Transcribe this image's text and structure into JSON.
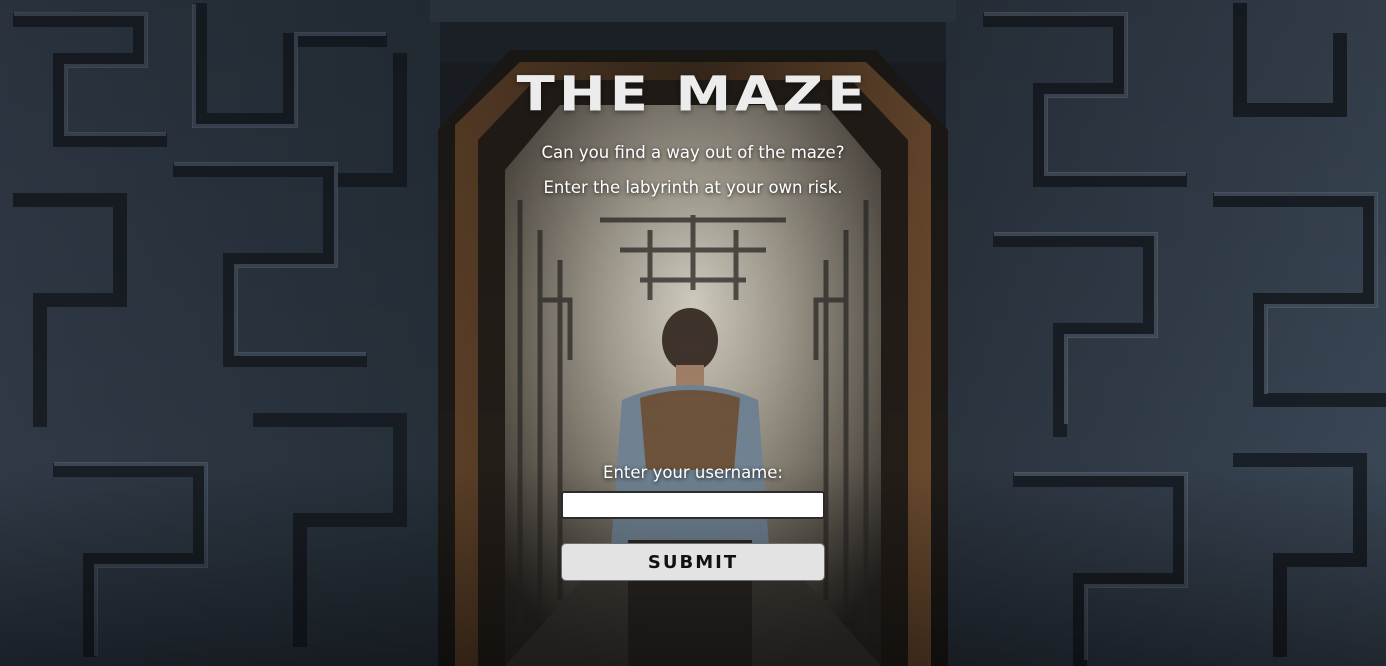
{
  "page": {
    "title": "THE MAZE",
    "tagline_1": "Can you find a way out of the maze?",
    "tagline_2": "Enter the labyrinth at your own risk."
  },
  "form": {
    "username_label": "Enter your username:",
    "username_value": "",
    "submit_label": "SUBMIT"
  },
  "colors": {
    "stone": "#3a4452",
    "stone_dark": "#1e242c",
    "doorway_glow": "#b9b3a6",
    "title_text": "#ececec",
    "button_bg": "#e3e3e3"
  }
}
